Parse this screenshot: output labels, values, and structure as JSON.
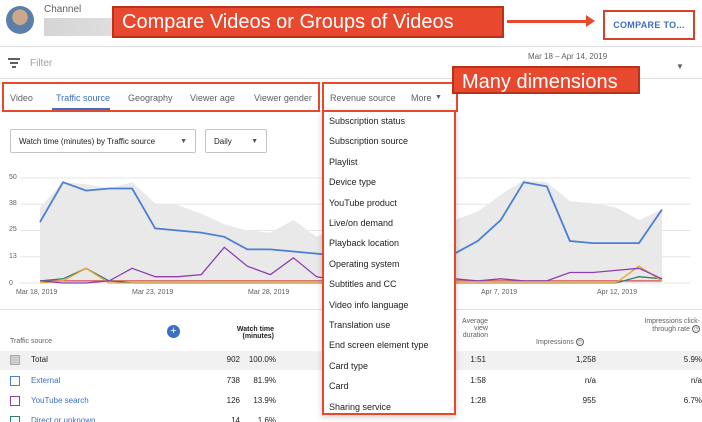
{
  "header": {
    "channel_label": "Channel",
    "compare_button": "COMPARE TO..."
  },
  "callouts": {
    "compare": "Compare Videos or Groups of Videos",
    "dimensions": "Many dimensions"
  },
  "filter": {
    "placeholder": "Filter",
    "date_range": "Mar 18 – Apr 14, 2019"
  },
  "tabs": [
    "Video",
    "Traffic source",
    "Geography",
    "Viewer age",
    "Viewer gender",
    "Revenue source",
    "More"
  ],
  "active_tab": "Traffic source",
  "controls": {
    "metric_select": "Watch time (minutes) by Traffic source",
    "interval_select": "Daily"
  },
  "chart_data": {
    "type": "line",
    "y_ticks": [
      "50",
      "38",
      "25",
      "13",
      "0"
    ],
    "x_ticks": [
      "Mar 18, 2019",
      "Mar 23, 2019",
      "Mar 28, 2019",
      "Apr 7, 2019",
      "Apr 12, 2019"
    ],
    "ylim": [
      0,
      50
    ],
    "x": [
      1,
      2,
      3,
      4,
      5,
      6,
      7,
      8,
      9,
      10,
      11,
      12,
      13,
      14,
      15,
      16,
      17,
      18,
      19,
      20,
      21,
      22,
      23,
      24,
      25,
      26,
      27,
      28
    ],
    "series": [
      {
        "values": [
          29,
          48,
          44,
          45,
          45,
          26,
          25,
          24,
          22,
          16,
          16,
          15,
          14,
          13,
          12,
          14,
          29,
          22,
          14,
          20,
          30,
          48,
          46,
          20,
          19,
          19,
          19,
          35
        ],
        "color": "#4a7fd4"
      },
      {
        "values": [
          1,
          0,
          0,
          1,
          7,
          3,
          3,
          4,
          17,
          8,
          4,
          12,
          3,
          1,
          1,
          2,
          6,
          3,
          2,
          1,
          2,
          1,
          1,
          5,
          5,
          6,
          7,
          2
        ],
        "color": "#8e3db3"
      },
      {
        "values": [
          0,
          1,
          7,
          0,
          0,
          0,
          0,
          0,
          0,
          0,
          0,
          0,
          0,
          0,
          0,
          0,
          0,
          0,
          0,
          0,
          0,
          0,
          0,
          0,
          0,
          0,
          8,
          1
        ],
        "color": "#e8a232"
      },
      {
        "values": [
          1,
          2,
          7,
          1,
          0,
          0,
          0,
          0,
          0,
          0,
          0,
          0,
          0,
          0,
          0,
          0,
          0,
          0,
          0,
          0,
          0,
          0,
          0,
          0,
          0,
          0,
          3,
          2
        ],
        "color": "#2e7d6f"
      },
      {
        "values": [
          1,
          1,
          1,
          1,
          1,
          1,
          1,
          1,
          1,
          1,
          1,
          1,
          1,
          1,
          1,
          1,
          1,
          1,
          1,
          1,
          1,
          1,
          1,
          1,
          1,
          1,
          1,
          1
        ],
        "color": "#d8504a"
      }
    ],
    "area_values": [
      36,
      48,
      47,
      45,
      48,
      38,
      37,
      33,
      28,
      25,
      24,
      30,
      22,
      27,
      25,
      26,
      38,
      40,
      30,
      34,
      42,
      49,
      48,
      39,
      38,
      36,
      30,
      35
    ]
  },
  "dropdown": {
    "items": [
      "Subscription status",
      "Subscription source",
      "Playlist",
      "Device type",
      "YouTube product",
      "Live/on demand",
      "Playback location",
      "Operating system",
      "Subtitles and CC",
      "Video info language",
      "Translation use",
      "End screen element type",
      "Card type",
      "Card",
      "Sharing service"
    ]
  },
  "table": {
    "headers": {
      "source": "Traffic source",
      "watch_time": "Watch time (minutes)",
      "avg_view": "Average view duration",
      "impressions": "Impressions",
      "ctr": "Impressions click-through rate"
    },
    "rows": [
      {
        "name": "Total",
        "watch": "902",
        "pct": "100.0%",
        "avg": "1:51",
        "impr": "1,258",
        "ctr": "5.9%",
        "color": "#b0b0b0"
      },
      {
        "name": "External",
        "watch": "738",
        "pct": "81.9%",
        "avg": "1:58",
        "impr": "n/a",
        "ctr": "n/a",
        "color": "#4a7fd4"
      },
      {
        "name": "YouTube search",
        "watch": "126",
        "pct": "13.9%",
        "avg": "1:28",
        "impr": "955",
        "ctr": "6.7%",
        "color": "#8e3db3"
      },
      {
        "name": "Direct or unknown",
        "watch": "14",
        "pct": "1.6%",
        "avg": "",
        "impr": "",
        "ctr": "",
        "color": "#2e7d6f"
      }
    ]
  }
}
